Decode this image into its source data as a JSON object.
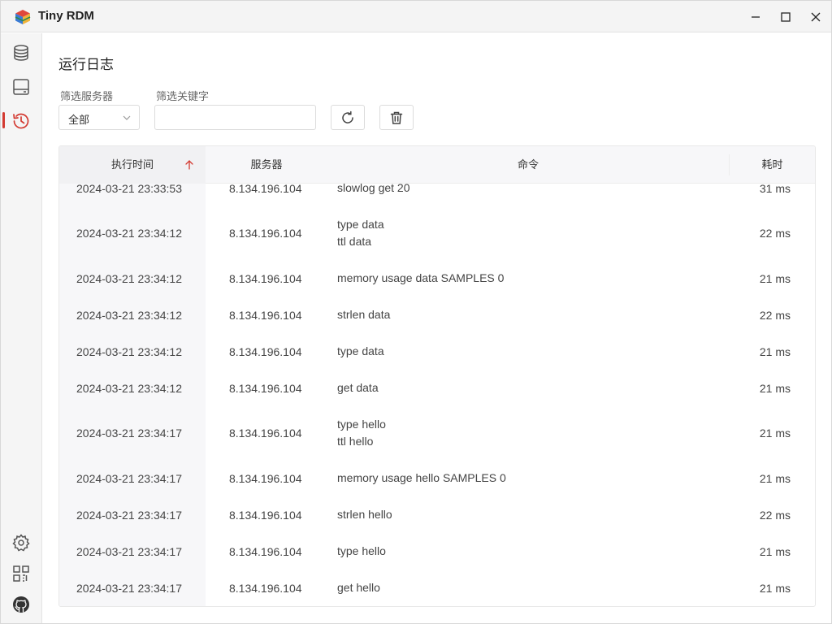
{
  "app": {
    "title": "Tiny RDM"
  },
  "window_controls": {
    "minimize": "minimize-icon",
    "maximize": "maximize-icon",
    "close": "close-icon"
  },
  "sidebar": {
    "items": [
      {
        "icon": "database-icon",
        "active": false
      },
      {
        "icon": "server-icon",
        "active": false
      },
      {
        "icon": "history-icon",
        "active": true
      }
    ],
    "bottom_items": [
      {
        "icon": "settings-icon"
      },
      {
        "icon": "apps-icon"
      },
      {
        "icon": "github-icon"
      }
    ],
    "accent_color": "#d33a31"
  },
  "page": {
    "title": "运行日志",
    "filter_server_label": "筛选服务器",
    "filter_server_value": "全部",
    "filter_keyword_label": "筛选关键字",
    "filter_keyword_value": "",
    "filter_keyword_placeholder": ""
  },
  "table": {
    "columns": {
      "time": "执行时间",
      "server": "服务器",
      "command": "命令",
      "cost": "耗时"
    },
    "sort": {
      "column": "time",
      "direction": "ascending"
    },
    "rows": [
      {
        "time": "2024-03-21 23:33:53",
        "server": "8.134.196.104",
        "command": [
          "slowlog get 20"
        ],
        "cost": "31 ms"
      },
      {
        "time": "2024-03-21 23:34:12",
        "server": "8.134.196.104",
        "command": [
          "type data",
          "ttl data"
        ],
        "cost": "22 ms"
      },
      {
        "time": "2024-03-21 23:34:12",
        "server": "8.134.196.104",
        "command": [
          "memory usage data SAMPLES 0"
        ],
        "cost": "21 ms"
      },
      {
        "time": "2024-03-21 23:34:12",
        "server": "8.134.196.104",
        "command": [
          "strlen data"
        ],
        "cost": "22 ms"
      },
      {
        "time": "2024-03-21 23:34:12",
        "server": "8.134.196.104",
        "command": [
          "type data"
        ],
        "cost": "21 ms"
      },
      {
        "time": "2024-03-21 23:34:12",
        "server": "8.134.196.104",
        "command": [
          "get data"
        ],
        "cost": "21 ms"
      },
      {
        "time": "2024-03-21 23:34:17",
        "server": "8.134.196.104",
        "command": [
          "type hello",
          "ttl hello"
        ],
        "cost": "21 ms"
      },
      {
        "time": "2024-03-21 23:34:17",
        "server": "8.134.196.104",
        "command": [
          "memory usage hello SAMPLES 0"
        ],
        "cost": "21 ms"
      },
      {
        "time": "2024-03-21 23:34:17",
        "server": "8.134.196.104",
        "command": [
          "strlen hello"
        ],
        "cost": "22 ms"
      },
      {
        "time": "2024-03-21 23:34:17",
        "server": "8.134.196.104",
        "command": [
          "type hello"
        ],
        "cost": "21 ms"
      },
      {
        "time": "2024-03-21 23:34:17",
        "server": "8.134.196.104",
        "command": [
          "get hello"
        ],
        "cost": "21 ms"
      }
    ]
  }
}
